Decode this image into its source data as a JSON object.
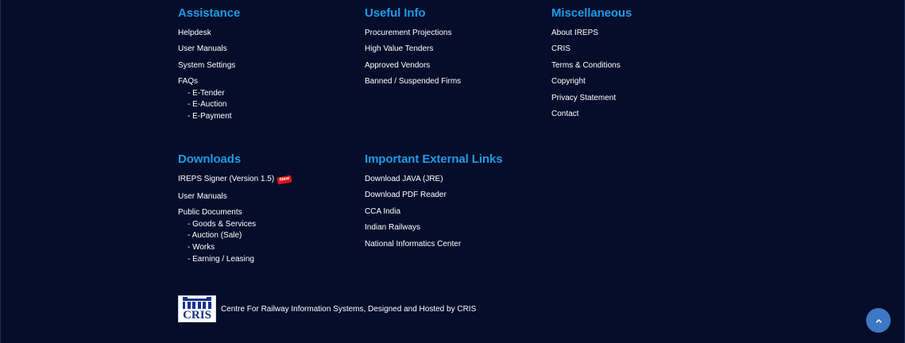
{
  "assistance": {
    "heading": "Assistance",
    "items": [
      "Helpdesk",
      "User Manuals",
      "System Settings",
      "FAQs"
    ],
    "faq_subitems": [
      "E-Tender",
      "E-Auction",
      "E-Payment"
    ]
  },
  "useful_info": {
    "heading": "Useful Info",
    "items": [
      "Procurement Projections",
      "High Value Tenders",
      "Approved Vendors",
      "Banned / Suspended Firms"
    ]
  },
  "miscellaneous": {
    "heading": "Miscellaneous",
    "items": [
      "About IREPS",
      "CRIS",
      "Terms & Conditions",
      "Copyright",
      "Privacy Statement",
      "Contact"
    ]
  },
  "downloads": {
    "heading": "Downloads",
    "items": [
      "IREPS Signer (Version 1.5)",
      "User Manuals",
      "Public Documents"
    ],
    "new_badge": "New",
    "public_doc_subitems": [
      "Goods & Services",
      "Auction (Sale)",
      "Works",
      "Earning / Leasing"
    ]
  },
  "external_links": {
    "heading": "Important External Links",
    "items": [
      "Download JAVA (JRE)",
      "Download PDF Reader",
      "CCA India",
      "Indian Railways",
      "National Informatics Center"
    ]
  },
  "footer": {
    "logo_text": "CRIS",
    "credit": "Centre For Railway Information Systems, Designed and Hosted by CRIS"
  },
  "colors": {
    "background": "#050d2a",
    "heading": "#1f9ae6",
    "scroll_button": "#3c78c4",
    "badge": "#d8141b"
  },
  "icons": {
    "scroll_top": "chevron-up-icon"
  }
}
